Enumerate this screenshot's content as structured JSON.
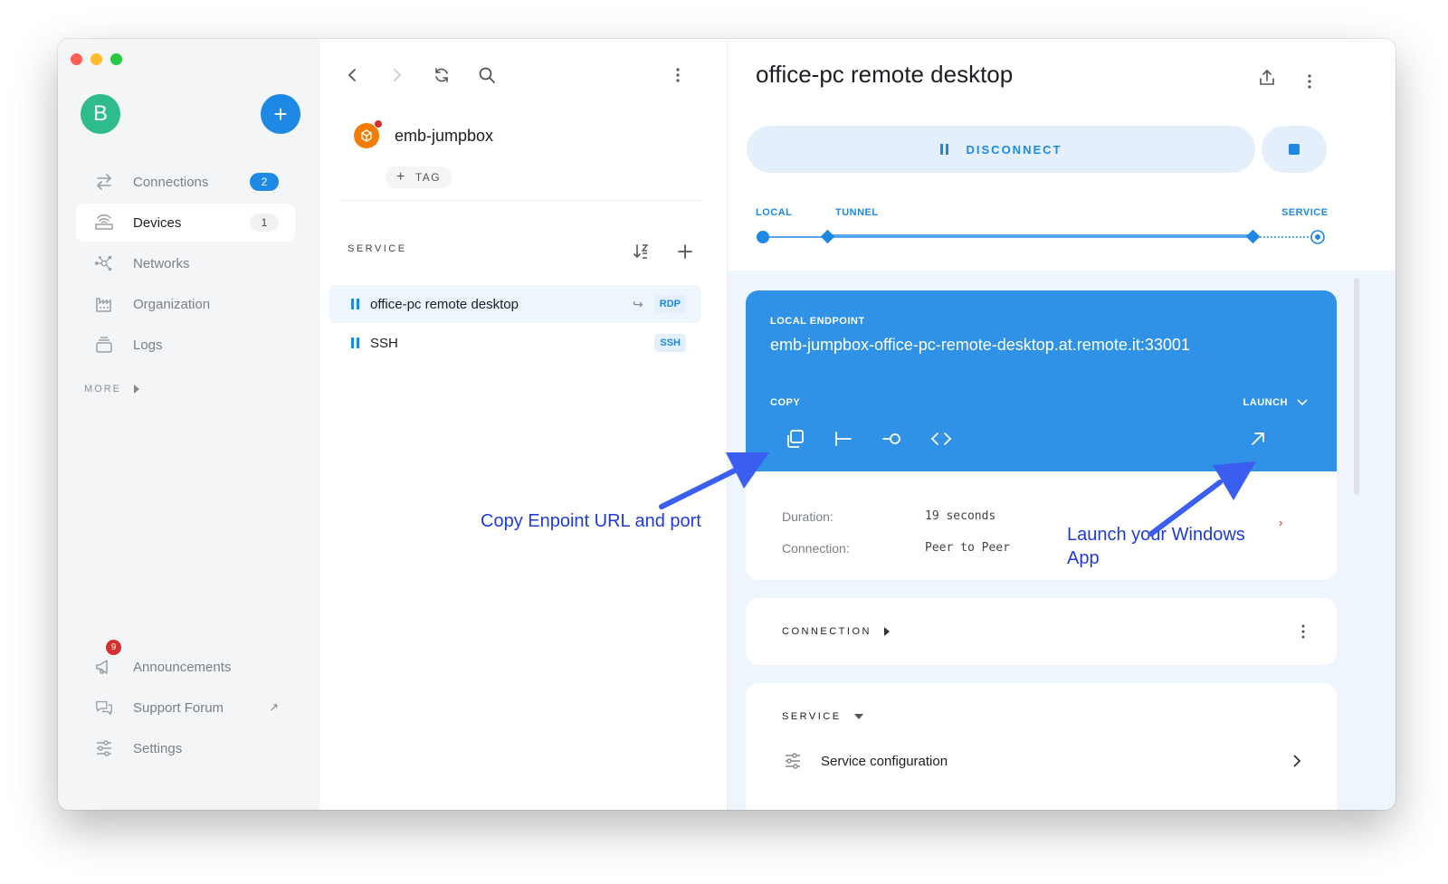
{
  "sidebar": {
    "avatar_letter": "B",
    "add_label": "+",
    "nav": [
      {
        "label": "Connections",
        "badge": "2",
        "icon": "arrows-icon"
      },
      {
        "label": "Devices",
        "badge": "1",
        "icon": "router-icon"
      },
      {
        "label": "Networks",
        "icon": "network-icon"
      },
      {
        "label": "Organization",
        "icon": "building-icon"
      },
      {
        "label": "Logs",
        "icon": "layers-icon"
      }
    ],
    "more_label": "MORE",
    "bottom": [
      {
        "label": "Announcements",
        "badge": "9"
      },
      {
        "label": "Support Forum",
        "ext": "↗"
      },
      {
        "label": "Settings"
      }
    ]
  },
  "middle": {
    "device_name": "emb-jumpbox",
    "tag_plus": "+",
    "tag_label": "TAG",
    "service_header": "SERVICE",
    "services": [
      {
        "name": "office-pc remote desktop",
        "tag": "RDP",
        "redirect": "↪"
      },
      {
        "name": "SSH",
        "tag": "SSH"
      }
    ]
  },
  "right": {
    "title": "office-pc remote desktop",
    "disconnect_label": "DISCONNECT",
    "path": {
      "local": "LOCAL",
      "tunnel": "TUNNEL",
      "service": "SERVICE"
    },
    "endpoint": {
      "label": "LOCAL ENDPOINT",
      "host": "emb-jumpbox-office-pc-remote-desktop.at.remote.it:33001",
      "copy_label": "COPY",
      "launch_label": "LAUNCH"
    },
    "stats": [
      {
        "key": "Duration:",
        "value": "19 seconds"
      },
      {
        "key": "Connection:",
        "value": "Peer to Peer"
      }
    ],
    "connection_header": "CONNECTION",
    "service_header": "SERVICE",
    "service_config": "Service configuration"
  },
  "annotations": {
    "copy": "Copy Enpoint URL and port",
    "launch_line1": "Launch your Windows",
    "launch_line2": "App"
  },
  "colors": {
    "accent": "#1e88e5",
    "endpoint_bg": "#2f92e6",
    "annotation": "#1f3bd8",
    "arrow": "#3a5ff0"
  }
}
